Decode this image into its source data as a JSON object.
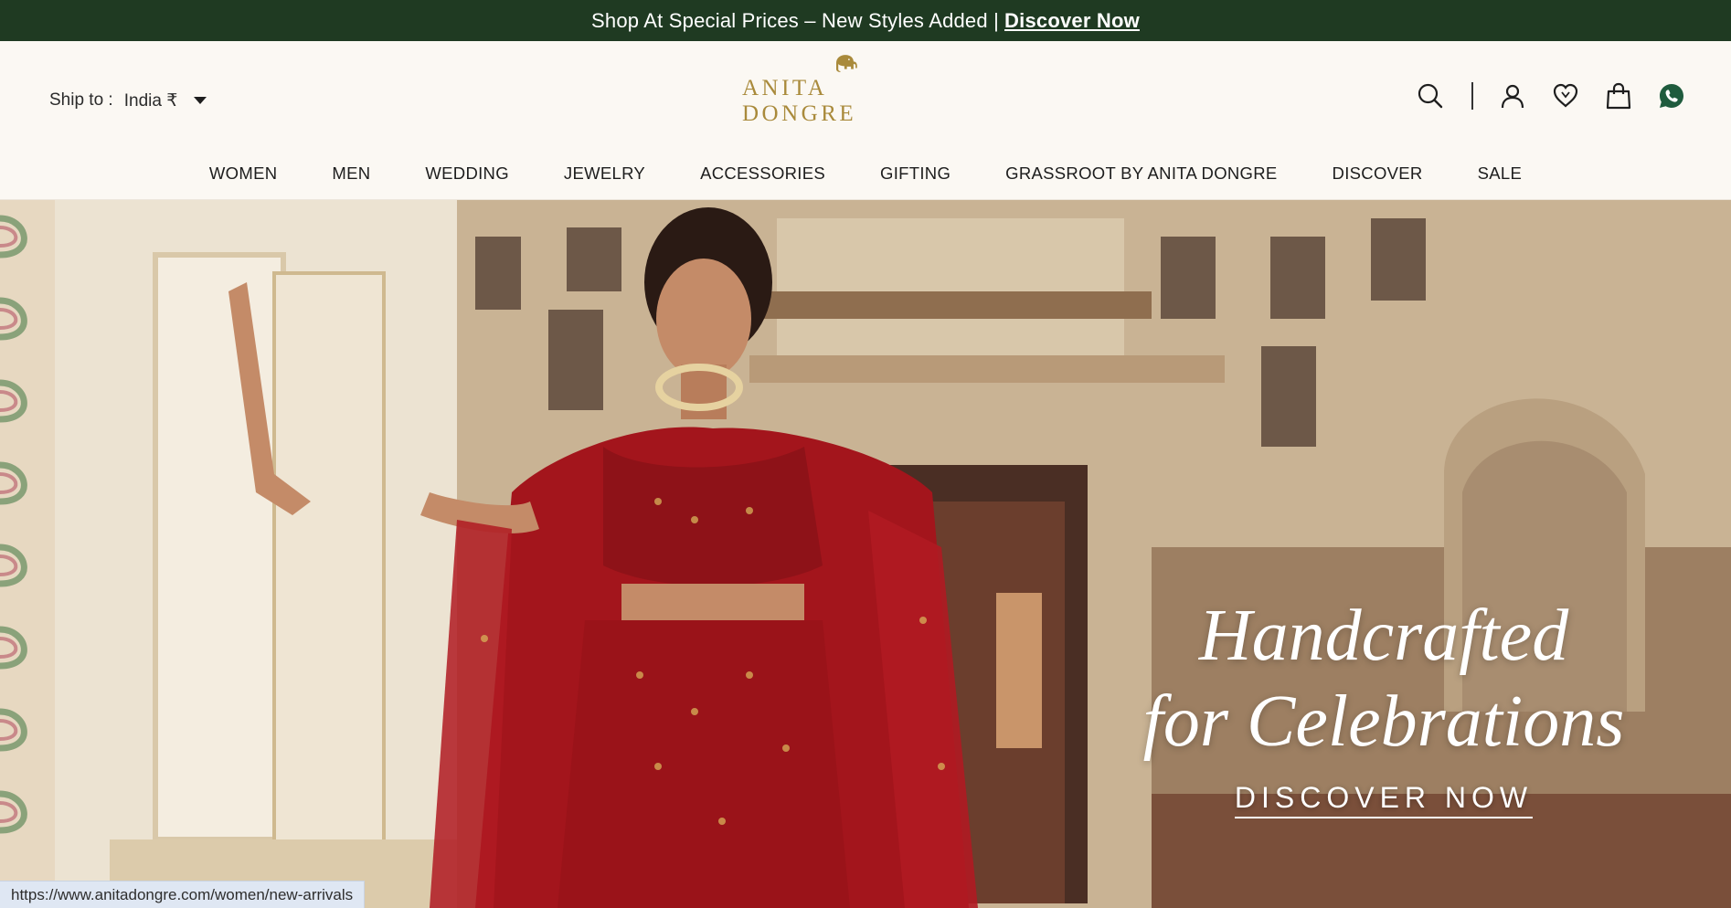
{
  "announcement": {
    "text": "Shop At Special Prices – New Styles Added |",
    "link": "Discover Now"
  },
  "header": {
    "ship_label": "Ship to :",
    "ship_value": "India ₹",
    "brand": "ANITA DONGRE",
    "icons": [
      "search-icon",
      "account-icon",
      "wishlist-icon",
      "cart-icon",
      "whatsapp-icon"
    ]
  },
  "nav": {
    "items": [
      "WOMEN",
      "MEN",
      "WEDDING",
      "JEWELRY",
      "ACCESSORIES",
      "GIFTING",
      "GRASSROOT BY ANITA DONGRE",
      "DISCOVER",
      "SALE"
    ]
  },
  "hero": {
    "title_line1": "Handcrafted",
    "title_line2": "for Celebrations",
    "cta": "DISCOVER NOW"
  },
  "status_bar": {
    "url": "https://www.anitadongre.com/women/new-arrivals"
  },
  "colors": {
    "announce_bg": "#1f3a22",
    "brand_gold": "#a98a3b",
    "page_bg": "#fbf8f3",
    "whatsapp": "#1f5b3d",
    "lehenga_red": "#a3151c"
  }
}
